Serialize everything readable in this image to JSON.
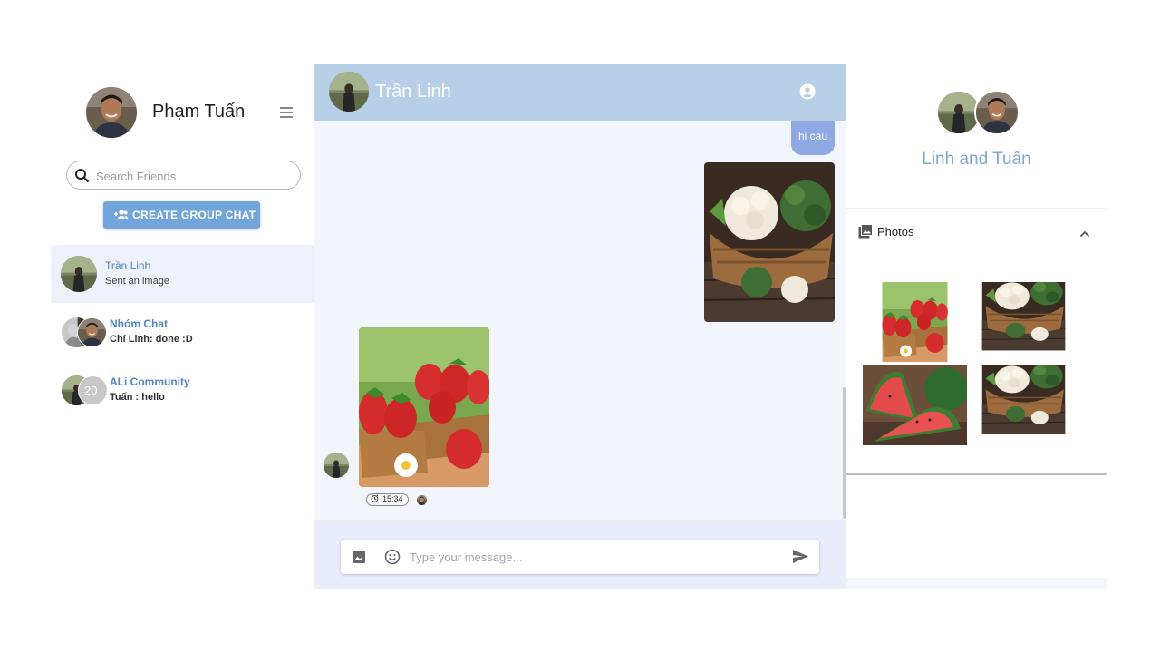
{
  "me": {
    "name": "Phạm Tuấn"
  },
  "search": {
    "placeholder": "Search Friends"
  },
  "create_group_label": "CREATE GROUP CHAT",
  "conversations": [
    {
      "name": "Trần Linh",
      "last_message": "Sent an image",
      "active": true
    },
    {
      "name": "Nhóm Chat",
      "last_message": "Chí Linh: done :D",
      "bold": true
    },
    {
      "name": "ALi Community",
      "last_message": "Tuấn : hello",
      "bold": true,
      "avatar_count_badge": "20"
    }
  ],
  "chat": {
    "header_name": "Trần Linh",
    "messages": [
      {
        "direction": "out",
        "type": "text",
        "text": "hi cau"
      },
      {
        "direction": "out",
        "type": "image",
        "subject": "cauliflower and broccoli"
      },
      {
        "direction": "in",
        "type": "image",
        "subject": "strawberries",
        "time": "15:34"
      }
    ],
    "composer_placeholder": "Type your message..."
  },
  "info": {
    "title": "Linh and Tuấn",
    "photos_label": "Photos",
    "photos": [
      "strawberries",
      "cauliflower and broccoli",
      "watermelon",
      "cauliflower and broccoli"
    ]
  },
  "colors": {
    "accent": "#72a6da",
    "header_bg": "#b7d0e7",
    "chat_bg": "#f3f5fc",
    "out_bubble": "#8fa9e3",
    "link_blue": "#4f86c1"
  },
  "icons": {
    "menu": "hamburger-icon",
    "search": "search-icon",
    "group_add": "group-add-icon",
    "account": "account-circle-icon",
    "image": "image-icon",
    "emoji": "emoji-icon",
    "send": "send-icon",
    "photos": "photo-library-icon",
    "collapse": "chevron-up-icon",
    "clock": "clock-icon"
  }
}
